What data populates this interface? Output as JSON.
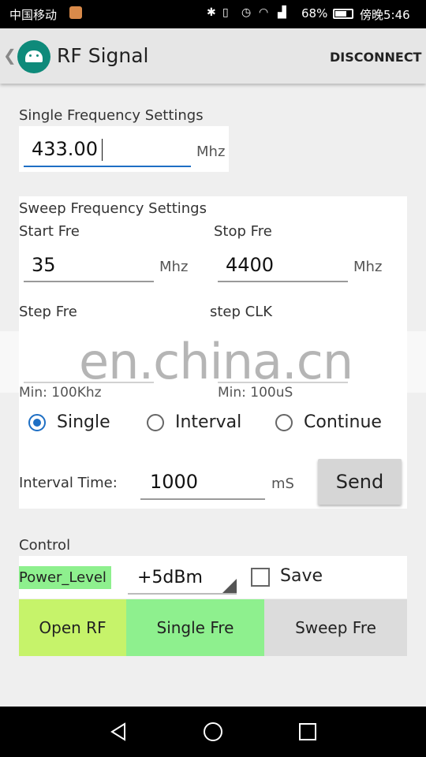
{
  "status_bar": {
    "carrier": "中国移动",
    "battery": "68%",
    "time": "傍晚5:46"
  },
  "app_bar": {
    "title": "RF Signal",
    "disconnect": "DISCONNECT"
  },
  "single_freq": {
    "heading": "Single Frequency Settings",
    "value": "433.00",
    "unit": "Mhz"
  },
  "sweep": {
    "heading": "Sweep Frequency Settings",
    "start_label": "Start Fre",
    "start_value": "35",
    "start_unit": "Mhz",
    "stop_label": "Stop Fre",
    "stop_value": "4400",
    "stop_unit": "Mhz",
    "step_label": "Step Fre",
    "clk_label": "step CLK",
    "step_min": "Min:  100Khz",
    "clk_min": "Min:  100uS",
    "modes": [
      "Single",
      "Interval",
      "Continue"
    ],
    "selected_mode": "Single",
    "interval_label": "Interval Time:",
    "interval_value": "1000",
    "interval_unit": "mS",
    "send": "Send"
  },
  "control": {
    "heading": "Control",
    "power_label": "Power_Level",
    "power_value": "+5dBm",
    "save_label": "Save",
    "save_checked": false
  },
  "buttons": {
    "open_rf": "Open RF",
    "single_fre": "Single Fre",
    "sweep_fre": "Sweep Fre"
  },
  "watermark": "en.china.cn",
  "colors": {
    "accent": "#1e6fc4",
    "power_label_bg": "#8ef08e",
    "open_rf_bg": "#c6f36a",
    "single_fre_bg": "#8ef08e",
    "sweep_fre_bg": "#dcdcdc"
  }
}
